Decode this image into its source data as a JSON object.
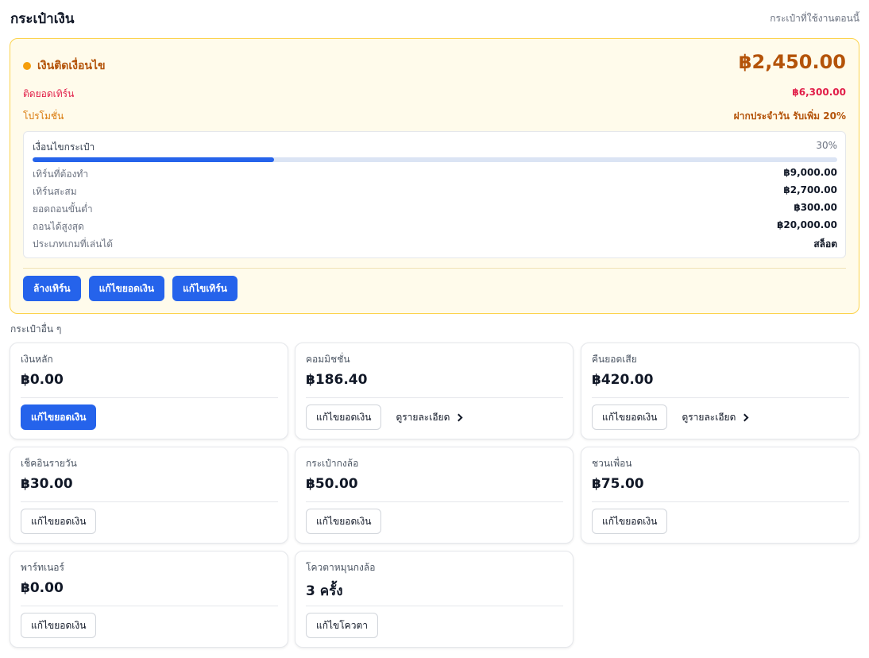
{
  "header": {
    "title": "กระเป๋าเงิน",
    "note": "กระเป๋าที่ใช้งานตอนนี้"
  },
  "active_wallet": {
    "status_label": "เงินติดเงื่อนไข",
    "amount": "฿2,450.00",
    "turnover_label": "ติดยอดเทิร์น",
    "turnover_value": "฿6,300.00",
    "promo_label": "โปรโมชั่น",
    "promo_value": "ฝากประจำวัน รับเพิ่ม 20%",
    "conditions": {
      "title": "เงื่อนไขกระเป๋า",
      "progress_label": "30%",
      "progress_fraction": 0.3,
      "rows": [
        {
          "label": "เทิร์นที่ต้องทำ",
          "value": "฿9,000.00"
        },
        {
          "label": "เทิร์นสะสม",
          "value": "฿2,700.00"
        },
        {
          "label": "ยอดถอนขั้นต่ำ",
          "value": "฿300.00"
        },
        {
          "label": "ถอนได้สูงสุด",
          "value": "฿20,000.00"
        },
        {
          "label": "ประเภทเกมที่เล่นได้",
          "value": "สล็อต"
        }
      ]
    },
    "buttons": {
      "clear_turnover": "ล้างเทิร์น",
      "edit_balance": "แก้ไขยอดเงิน",
      "edit_turnover": "แก้ไขเทิร์น"
    }
  },
  "other_wallets_title": "กระเป๋าอื่น ๆ",
  "wallets": [
    {
      "name": "เงินหลัก",
      "amount": "฿0.00",
      "action": "แก้ไขยอดเงิน"
    },
    {
      "name": "คอมมิชชั่น",
      "amount": "฿186.40",
      "action": "แก้ไขยอดเงิน",
      "detail": "ดูรายละเอียด"
    },
    {
      "name": "คืนยอดเสีย",
      "amount": "฿420.00",
      "action": "แก้ไขยอดเงิน",
      "detail": "ดูรายละเอียด"
    },
    {
      "name": "เช็คอินรายวัน",
      "amount": "฿30.00",
      "action": "แก้ไขยอดเงิน"
    },
    {
      "name": "กระเป๋ากงล้อ",
      "amount": "฿50.00",
      "action": "แก้ไขยอดเงิน"
    },
    {
      "name": "ชวนเพื่อน",
      "amount": "฿75.00",
      "action": "แก้ไขยอดเงิน"
    },
    {
      "name": "พาร์ทเนอร์",
      "amount": "฿0.00",
      "action": "แก้ไขยอดเงิน"
    },
    {
      "name": "โควตาหมุนกงล้อ",
      "amount": "3 ครั้ง",
      "action": "แก้ไขโควตา"
    }
  ],
  "colors": {
    "accent": "#2563eb",
    "warning": "#f59e0b",
    "amber_text": "#b45309",
    "turnover_text": "#e11d48"
  }
}
